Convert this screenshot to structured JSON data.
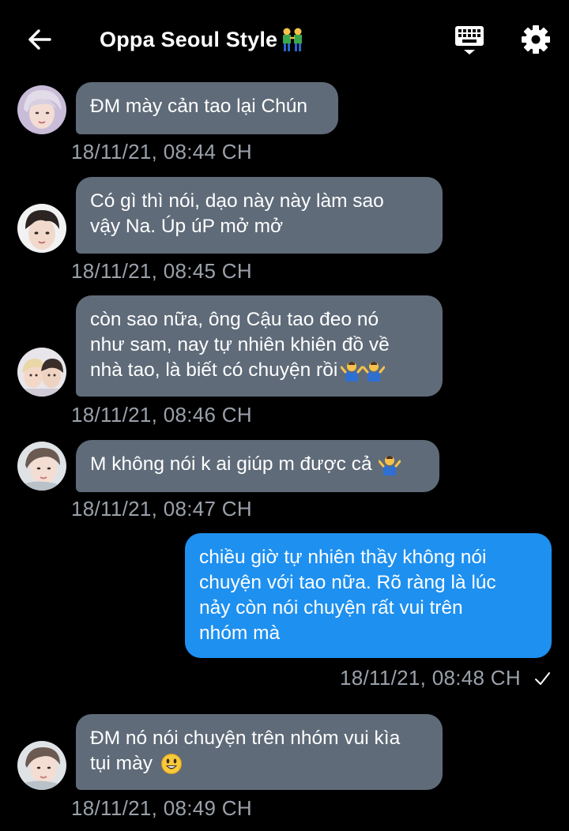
{
  "header": {
    "title": "Oppa Seoul Style"
  },
  "messages": [
    {
      "lines": [
        "ĐM mày cản tao lại Chún"
      ],
      "time": "18/11/21, 08:44 CH"
    },
    {
      "lines": [
        "Có gì thì nói, dạo này này làm sao",
        "vậy Na. Úp úP mở mở"
      ],
      "time": "18/11/21, 08:45 CH"
    },
    {
      "lines": [
        "còn sao nữa, ông Cậu tao đeo nó",
        "như sam, nay tự nhiên khiên đồ về",
        "nhà tao, là biết có chuyện rồi"
      ],
      "time": "18/11/21, 08:46 CH"
    },
    {
      "lines": [
        "M không nói k ai giúp m được cả"
      ],
      "time": "18/11/21, 08:47 CH"
    },
    {
      "lines": [
        "chiều giờ tự nhiên thầy không nói",
        "chuyện với tao nữa. Rõ ràng là lúc",
        "nảy còn nói chuyện rất vui trên",
        "nhóm mà"
      ],
      "time": "18/11/21, 08:48 CH"
    },
    {
      "lines": [
        "ĐM nó nói chuyện trên nhóm vui kìa",
        "tụi mày"
      ],
      "time": "18/11/21, 08:49 CH"
    }
  ],
  "colors": {
    "incoming_bubble": "#5f6b79",
    "outgoing_bubble": "#1e90f0",
    "timestamp": "#9aa1aa",
    "background": "#000000"
  },
  "icons": [
    "back-arrow-icon",
    "keyboard-icon",
    "gear-icon",
    "couple-emoji-icon",
    "shrug-emoji-icon",
    "smile-emoji-icon",
    "check-icon"
  ]
}
